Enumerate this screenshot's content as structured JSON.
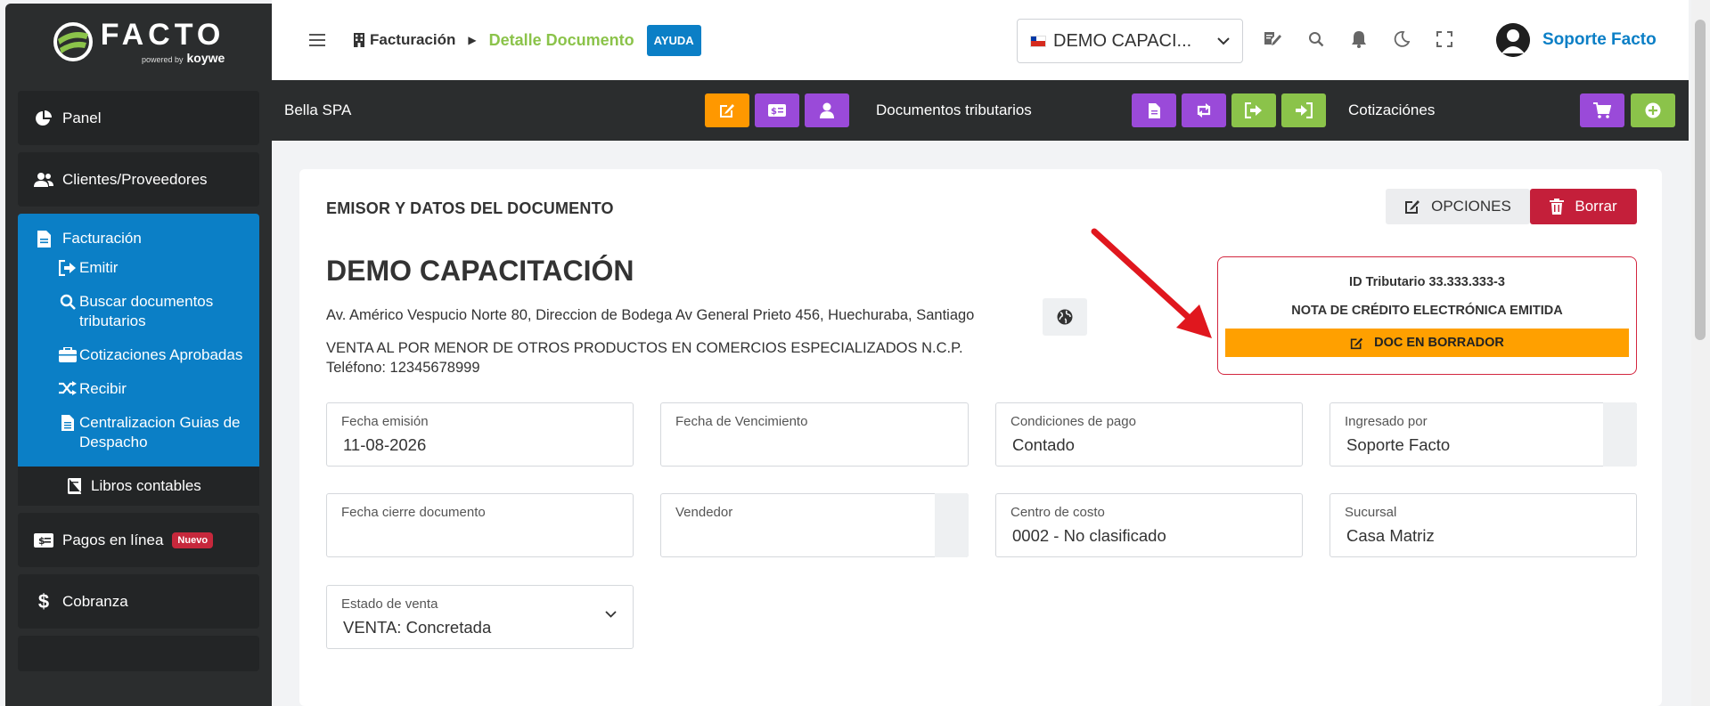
{
  "logo": {
    "word": "FACTO",
    "powered": "powered by",
    "brand": "koywe"
  },
  "sidebar": {
    "items": [
      {
        "label": "Panel",
        "icon": "pie-chart-icon"
      },
      {
        "label": "Clientes/Proveedores",
        "icon": "users-icon"
      }
    ],
    "group": {
      "label": "Facturación",
      "icon": "file-icon",
      "sub_items": [
        {
          "label": "Emitir",
          "icon": "sign-out-icon"
        },
        {
          "label": "Buscar documentos tributarios",
          "icon": "search-icon"
        },
        {
          "label": "Cotizaciones Aprobadas",
          "icon": "briefcase-icon"
        },
        {
          "label": "Recibir",
          "icon": "shuffle-icon"
        },
        {
          "label": "Centralizacion Guias de Despacho",
          "icon": "file-text-icon"
        }
      ],
      "plain_item": {
        "label": "Libros contables",
        "icon": "book-icon"
      }
    },
    "after_items": [
      {
        "label": "Pagos en línea",
        "icon": "money-icon",
        "badge": "Nuevo"
      },
      {
        "label": "Cobranza",
        "icon": "dollar-icon"
      }
    ]
  },
  "header": {
    "breadcrumb_root": "Facturación",
    "breadcrumb_current": "Detalle Documento",
    "help_label": "AYUDA",
    "company_select": "DEMO CAPACI...",
    "user_name": "Soporte Facto"
  },
  "actionbar": {
    "client_name": "Bella SPA",
    "label_docs": "Documentos tributarios",
    "label_quotes": "Cotizaciónes"
  },
  "document": {
    "section_title": "EMISOR Y DATOS DEL DOCUMENTO",
    "options_label": "OPCIONES",
    "delete_label": "Borrar",
    "emisor_name": "DEMO CAPACITACIÓN",
    "address": "Av. Américo Vespucio Norte 80, Direccion de Bodega Av General Prieto 456, Huechuraba, Santiago",
    "giro": "VENTA AL POR MENOR DE OTROS PRODUCTOS EN COMERCIOS ESPECIALIZADOS N.C.P.",
    "phone": "Teléfono: 12345678999",
    "status": {
      "tax_id": "ID Tributario 33.333.333-3",
      "doc_type": "NOTA DE CRÉDITO ELECTRÓNICA EMITIDA",
      "state": "DOC EN BORRADOR"
    },
    "fields": {
      "fecha_emision": {
        "label": "Fecha emisión",
        "value": "11-08-2026"
      },
      "fecha_vencimiento": {
        "label": "Fecha de Vencimiento",
        "value": ""
      },
      "condiciones_pago": {
        "label": "Condiciones de pago",
        "value": "Contado"
      },
      "ingresado_por": {
        "label": "Ingresado por",
        "value": "Soporte Facto"
      },
      "fecha_cierre": {
        "label": "Fecha cierre documento",
        "value": ""
      },
      "vendedor": {
        "label": "Vendedor",
        "value": ""
      },
      "centro_costo": {
        "label": "Centro de costo",
        "value": "0002 - No clasificado"
      },
      "sucursal": {
        "label": "Sucursal",
        "value": "Casa Matriz"
      },
      "estado_venta": {
        "label": "Estado de venta",
        "value": "VENTA: Concretada"
      }
    }
  },
  "colors": {
    "sidebar_bg": "#2b2d2e",
    "accent_blue": "#0b7fc6",
    "accent_green": "#8bc34a",
    "accent_orange": "#ff9800",
    "accent_purple": "#9a4ad9",
    "danger": "#c41f3a"
  }
}
